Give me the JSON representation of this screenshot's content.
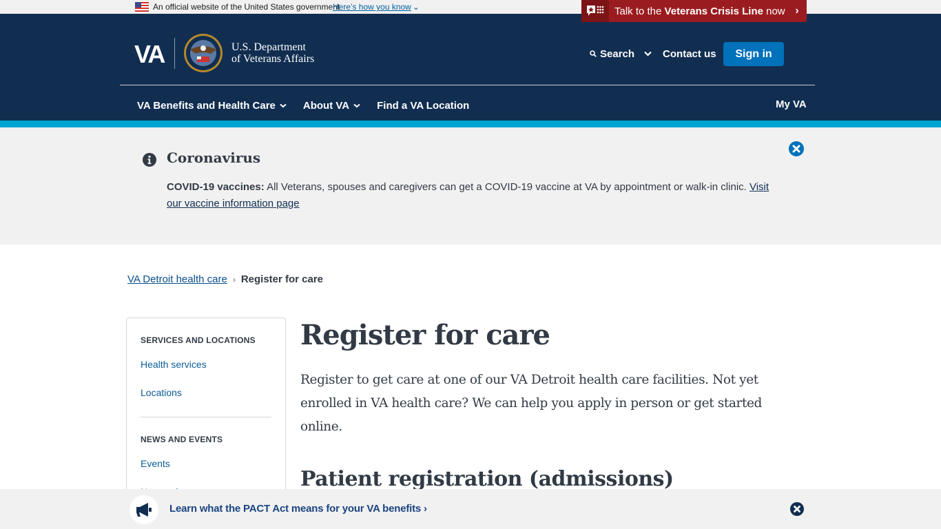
{
  "official_banner": {
    "text": "An official website of the United States government",
    "link": "Here’s how you know"
  },
  "crisis_line": {
    "prefix": "Talk to the ",
    "bold": "Veterans Crisis Line",
    "suffix": " now"
  },
  "header": {
    "logo_va": "VA",
    "dept_line1": "U.S. Department",
    "dept_line2": "of Veterans Affairs",
    "search_label": "Search",
    "contact_label": "Contact us",
    "signin_label": "Sign in"
  },
  "nav": {
    "items": [
      {
        "label": "VA Benefits and Health Care",
        "has_dropdown": true
      },
      {
        "label": "About VA",
        "has_dropdown": true
      },
      {
        "label": "Find a VA Location",
        "has_dropdown": false
      }
    ],
    "my_va": "My VA"
  },
  "alert": {
    "title": "Coronavirus",
    "bold_lead": "COVID-19 vaccines:",
    "body": " All Veterans, spouses and caregivers can get a COVID-19 vaccine at VA by appointment or walk-in clinic. ",
    "link": "Visit our vaccine information page"
  },
  "breadcrumb": {
    "parent": "VA Detroit health care",
    "separator": "›",
    "current": "Register for care"
  },
  "sidebar": {
    "sections": [
      {
        "heading": "SERVICES AND LOCATIONS",
        "links": [
          "Health services",
          "Locations"
        ]
      },
      {
        "heading": "NEWS AND EVENTS",
        "links": [
          "Events",
          "News releases"
        ]
      }
    ]
  },
  "main": {
    "title": "Register for care",
    "intro": "Register to get care at one of our VA Detroit health care facilities. Not yet enrolled in VA health care? We can help you apply in person or get started online.",
    "subheading": "Patient registration (admissions)"
  },
  "pact_banner": {
    "link": "Learn what the PACT Act means for your VA benefits",
    "chevron": "›"
  },
  "colors": {
    "header_bg": "#112e51",
    "accent_teal": "#02a5d2",
    "crisis_red": "#9b1c20",
    "signin_blue": "#0071bb",
    "alert_bg": "#f1f1f1"
  }
}
